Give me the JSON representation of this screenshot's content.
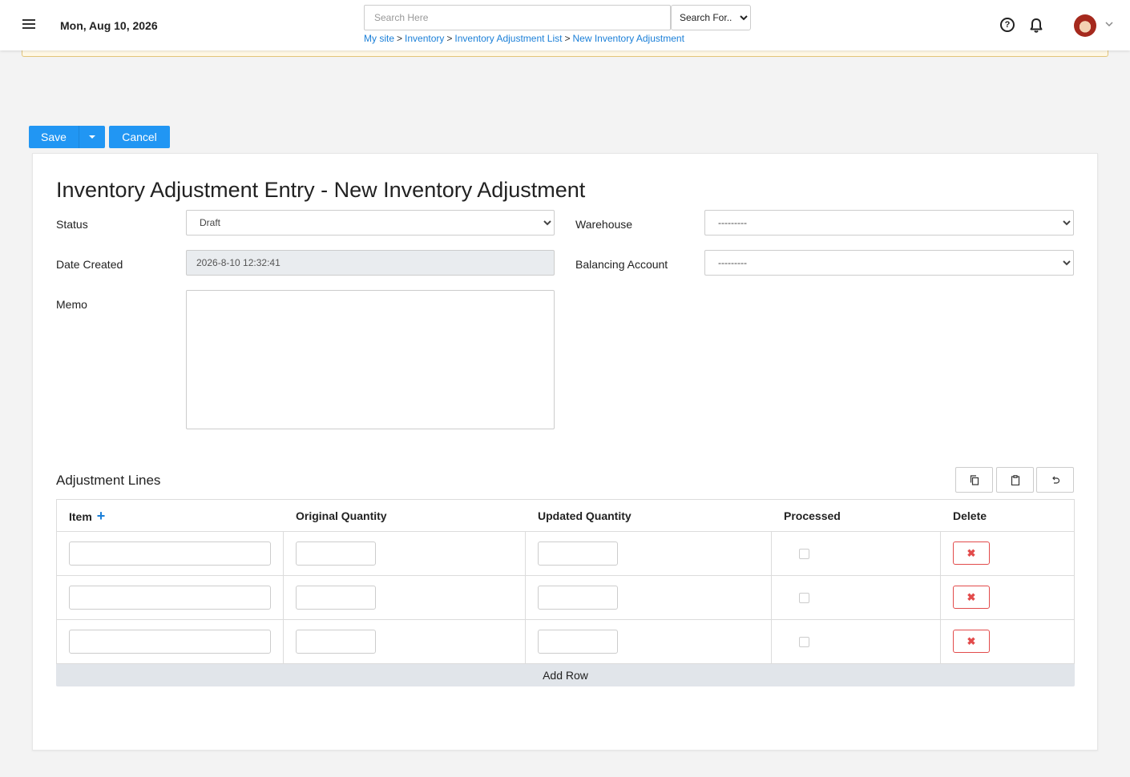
{
  "header": {
    "date": "Mon, Aug 10, 2026",
    "search_placeholder": "Search Here",
    "search_for": "Search For...",
    "breadcrumb": [
      "My site",
      "Inventory",
      "Inventory Adjustment List",
      "New Inventory Adjustment"
    ],
    "breadcrumb_separator": ">"
  },
  "icons": {
    "menu": "hamburger-icon",
    "help": "question-circle-icon",
    "notifications": "bell-icon",
    "account": "chevron-down-icon"
  },
  "actions": {
    "save": "Save",
    "cancel": "Cancel"
  },
  "form": {
    "title": "Inventory Adjustment Entry - New Inventory Adjustment",
    "status_label": "Status",
    "status_value": "Draft",
    "date_created_label": "Date Created",
    "date_created_value": "2026-8-10 12:32:41",
    "memo_label": "Memo",
    "warehouse_label": "Warehouse",
    "warehouse_value": "---------",
    "balancing_account_label": "Balancing Account",
    "balancing_account_value": "---------"
  },
  "lines": {
    "title": "Adjustment Lines",
    "columns": [
      "Item",
      "Original Quantity",
      "Updated Quantity",
      "Processed",
      "Delete"
    ],
    "add_row": "Add Row",
    "row_count": 3
  },
  "colors": {
    "primary": "#2196f3",
    "link": "#1a7fd8",
    "danger": "#e24b4b",
    "warning_border": "#e2c57a"
  }
}
